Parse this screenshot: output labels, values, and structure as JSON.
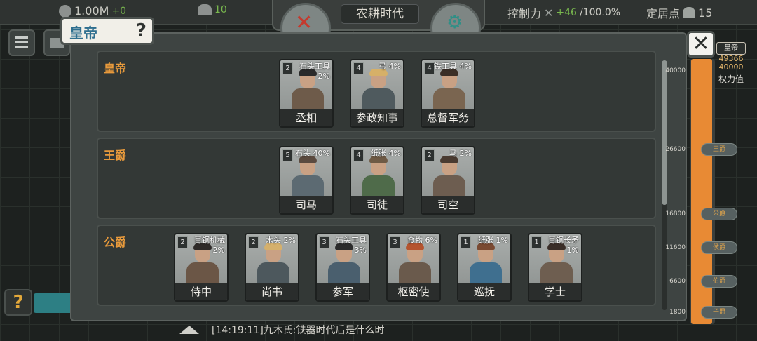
{
  "topbar": {
    "gold": "1.00M",
    "gold_rate": "+0",
    "strength": "10",
    "era_title": "农耕时代",
    "control_label": "控制力",
    "control_delta": "+46",
    "control_value": "/100.0%",
    "settle_label": "定居点",
    "settle_value": "15"
  },
  "header": {
    "title": "皇帝",
    "help": "?"
  },
  "close_label": "✕",
  "help_label": "?",
  "rows": [
    {
      "title": "皇帝",
      "cards": [
        {
          "level": "2",
          "bonus": "石头工具 2%",
          "name": "丞相",
          "hair": "#2a2a2a",
          "body": "#6e5b4a"
        },
        {
          "level": "4",
          "bonus": "弓 4%",
          "name": "参政知事",
          "hair": "#d6b068",
          "body": "#4f5a5e"
        },
        {
          "level": "4",
          "bonus": "铁工具 4%",
          "name": "总督军务",
          "hair": "#3b2f27",
          "body": "#7a6550"
        }
      ]
    },
    {
      "title": "王爵",
      "cards": [
        {
          "level": "5",
          "bonus": "石头 40%",
          "name": "司马",
          "hair": "#5b4a3f",
          "body": "#5c6a72"
        },
        {
          "level": "4",
          "bonus": "纸张 4%",
          "name": "司徒",
          "hair": "#6e5a45",
          "body": "#4f6b4a"
        },
        {
          "level": "2",
          "bonus": "马 2%",
          "name": "司空",
          "hair": "#4a3b31",
          "body": "#6d5d50"
        }
      ]
    },
    {
      "title": "公爵",
      "cards": [
        {
          "level": "2",
          "bonus": "青铜机械 2%",
          "name": "侍中",
          "hair": "#2e2a28",
          "body": "#6b5646"
        },
        {
          "level": "2",
          "bonus": "木头 2%",
          "name": "尚书",
          "hair": "#d5b06c",
          "body": "#4d585d"
        },
        {
          "level": "3",
          "bonus": "石头工具 3%",
          "name": "参军",
          "hair": "#2b2b2b",
          "body": "#4a5f6e"
        },
        {
          "level": "3",
          "bonus": "食物 6%",
          "name": "枢密使",
          "hair": "#b5542f",
          "body": "#6a5a4c"
        },
        {
          "level": "1",
          "bonus": "纸张 1%",
          "name": "巡抚",
          "hair": "#7a4a32",
          "body": "#3f6f8f"
        },
        {
          "level": "1",
          "bonus": "青铜长矛 1%",
          "name": "学士",
          "hair": "#3a2e28",
          "body": "#6e5e50"
        }
      ]
    }
  ],
  "power": {
    "badge": "皇帝",
    "current": "49366",
    "max": "40000",
    "label": "权力值",
    "fill_fraction": 1.0,
    "ticks": [
      "40000",
      "26600",
      "16800",
      "11600",
      "6600",
      "1800"
    ],
    "ranks": [
      "王爵",
      "公爵",
      "侯爵",
      "伯爵",
      "子爵"
    ]
  },
  "chat": {
    "message": "[14:19:11]九木氏:铁器时代后是什么时"
  },
  "colors": {
    "accent_orange": "#e88a34",
    "rank_title": "#e89a3c",
    "header_blue": "#2f6f8f"
  }
}
